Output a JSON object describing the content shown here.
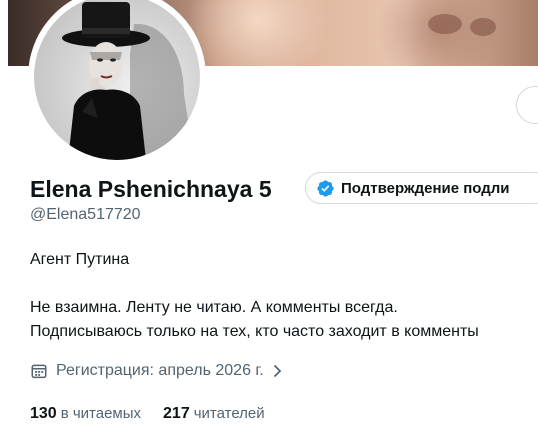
{
  "profile": {
    "display_name": "Elena Pshenichnaya 5",
    "handle": "@Elena517720",
    "verify_label": "Подтверждение подли",
    "bio_line1": "Агент Путина",
    "bio_line2": "Не взаимна. Ленту не читаю. А комменты всегда.",
    "bio_line3": "Подписываюсь только на тех, кто часто заходит в комменты",
    "joined": "Регистрация: апрель 2026 г."
  },
  "stats": {
    "following_count": "130",
    "following_label": "в читаемых",
    "followers_count": "217",
    "followers_label": "читателей"
  },
  "colors": {
    "accent": "#1d9bf0",
    "secondary_text": "#536471",
    "primary_text": "#0f1419"
  },
  "icons": [
    "verified-check-icon",
    "calendar-icon",
    "chevron-right-icon"
  ]
}
